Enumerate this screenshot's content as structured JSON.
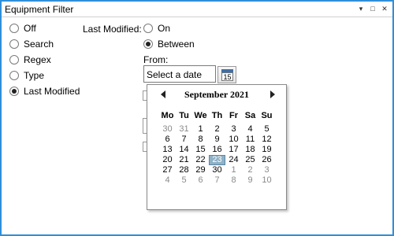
{
  "window": {
    "title": "Equipment Filter",
    "controls": [
      "▾",
      "□",
      "✕"
    ],
    "accent_color": "#2f8fd8"
  },
  "filter_options": [
    {
      "label": "Off",
      "checked": false
    },
    {
      "label": "Search",
      "checked": false
    },
    {
      "label": "Regex",
      "checked": false
    },
    {
      "label": "Type",
      "checked": false
    },
    {
      "label": "Last Modified",
      "checked": true
    }
  ],
  "last_modified": {
    "label": "Last Modified:",
    "options": [
      {
        "label": "On",
        "checked": false
      },
      {
        "label": "Between",
        "checked": true
      }
    ],
    "from_label": "From:",
    "date_placeholder": "Select a date",
    "calendar_button_icon_text": "15"
  },
  "calendar": {
    "month_label": "September 2021",
    "weekdays": [
      "Mo",
      "Tu",
      "We",
      "Th",
      "Fr",
      "Sa",
      "Su"
    ],
    "weeks": [
      [
        {
          "d": "30",
          "o": true
        },
        {
          "d": "31",
          "o": true
        },
        {
          "d": "1"
        },
        {
          "d": "2"
        },
        {
          "d": "3"
        },
        {
          "d": "4"
        },
        {
          "d": "5"
        }
      ],
      [
        {
          "d": "6"
        },
        {
          "d": "7"
        },
        {
          "d": "8"
        },
        {
          "d": "9"
        },
        {
          "d": "10"
        },
        {
          "d": "11"
        },
        {
          "d": "12"
        }
      ],
      [
        {
          "d": "13"
        },
        {
          "d": "14"
        },
        {
          "d": "15"
        },
        {
          "d": "16"
        },
        {
          "d": "17"
        },
        {
          "d": "18"
        },
        {
          "d": "19"
        }
      ],
      [
        {
          "d": "20"
        },
        {
          "d": "21"
        },
        {
          "d": "22"
        },
        {
          "d": "23",
          "s": true
        },
        {
          "d": "24"
        },
        {
          "d": "25"
        },
        {
          "d": "26"
        }
      ],
      [
        {
          "d": "27"
        },
        {
          "d": "28"
        },
        {
          "d": "29"
        },
        {
          "d": "30"
        },
        {
          "d": "1",
          "o": true
        },
        {
          "d": "2",
          "o": true
        },
        {
          "d": "3",
          "o": true
        }
      ],
      [
        {
          "d": "4",
          "o": true
        },
        {
          "d": "5",
          "o": true
        },
        {
          "d": "6",
          "o": true
        },
        {
          "d": "7",
          "o": true
        },
        {
          "d": "8",
          "o": true
        },
        {
          "d": "9",
          "o": true
        },
        {
          "d": "10",
          "o": true
        }
      ]
    ]
  }
}
